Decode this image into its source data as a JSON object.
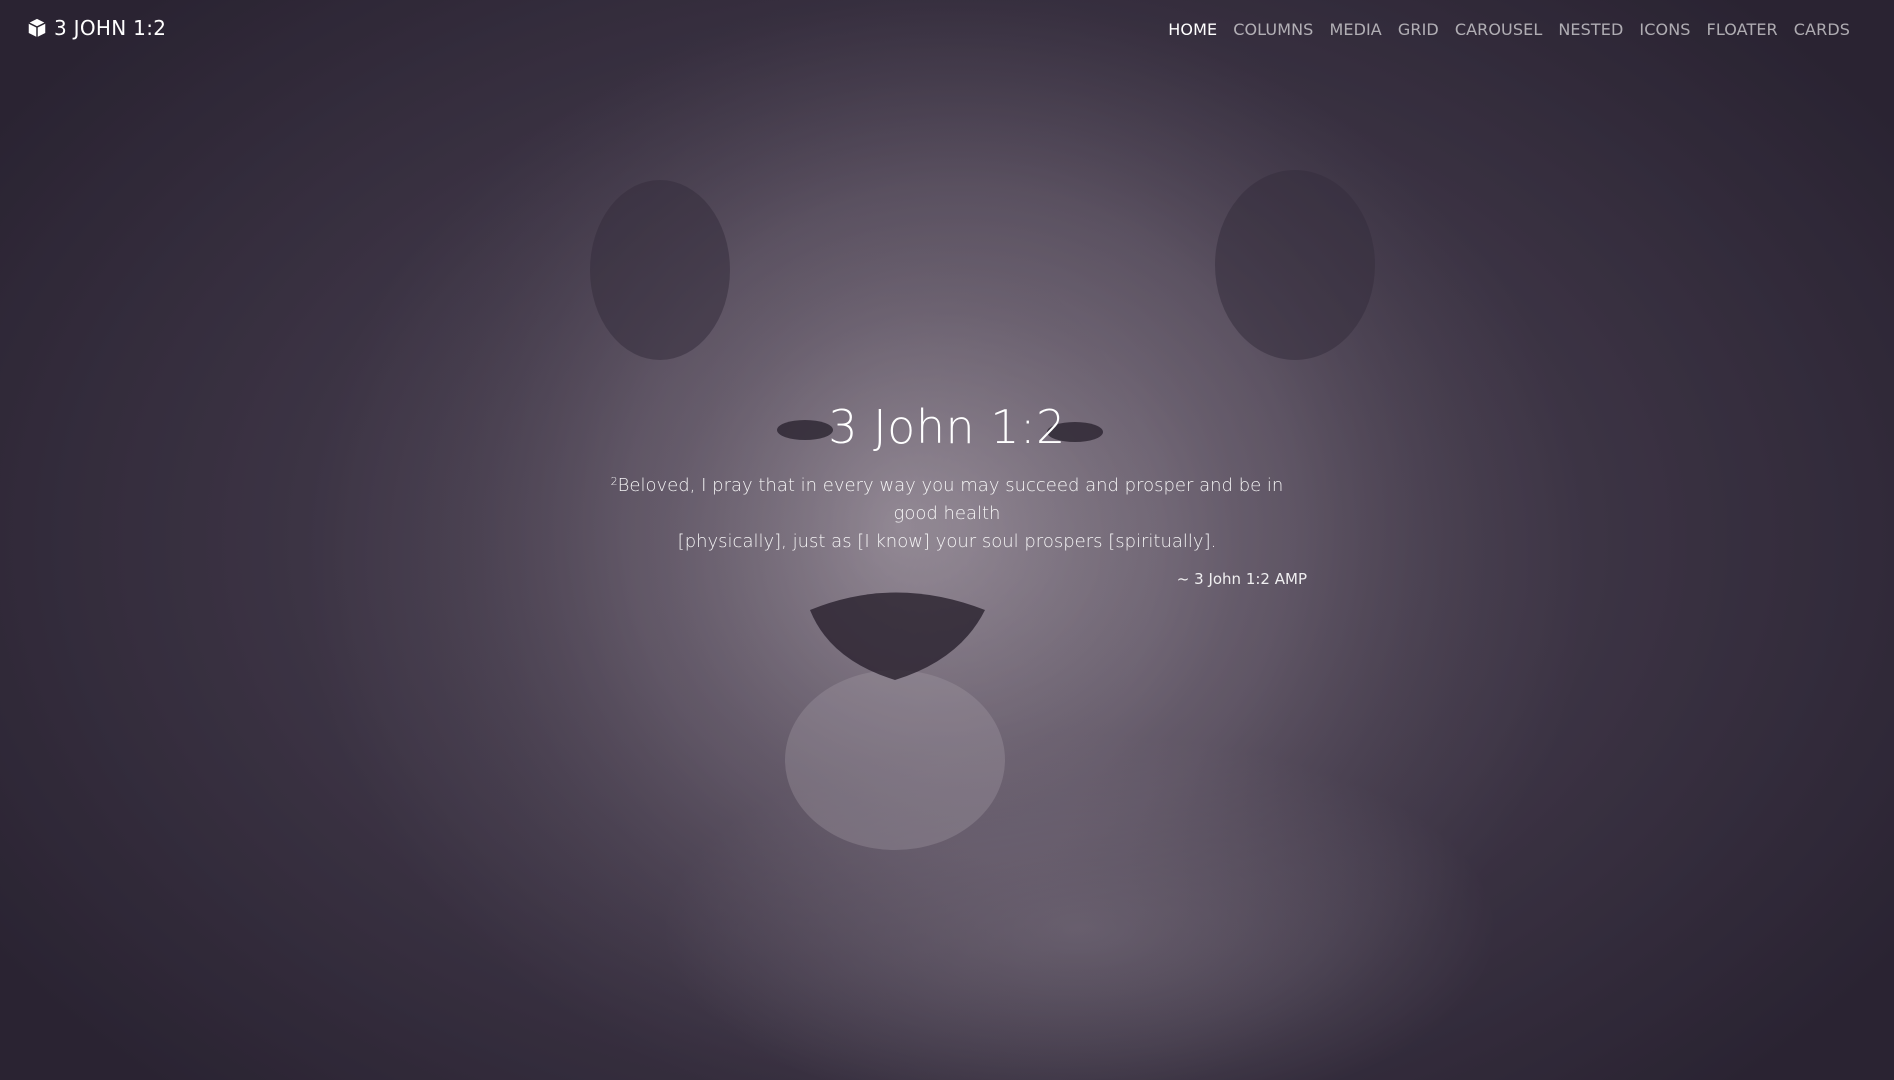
{
  "navbar": {
    "brand_label": "3 JOHN 1:2",
    "brand_icon": "cube-icon",
    "items": [
      {
        "label": "HOME",
        "active": true
      },
      {
        "label": "COLUMNS",
        "active": false
      },
      {
        "label": "MEDIA",
        "active": false
      },
      {
        "label": "GRID",
        "active": false
      },
      {
        "label": "CAROUSEL",
        "active": false
      },
      {
        "label": "NESTED",
        "active": false
      },
      {
        "label": "ICONS",
        "active": false
      },
      {
        "label": "FLOATER",
        "active": false
      },
      {
        "label": "CARDS",
        "active": false
      }
    ]
  },
  "hero": {
    "title": "3 John 1:2",
    "verse_number": "2",
    "verse_text_line1": "Beloved, I pray that in every way you may succeed and prosper and be in good health",
    "verse_text_line2": "[physically], just as [I know] your soul prospers [spiritually].",
    "citation": "~ 3 John 1:2 AMP",
    "background_image": "lion-photo"
  },
  "colors": {
    "background": "#2a2530",
    "text": "#ffffff",
    "nav_inactive": "#b0a8b4"
  }
}
